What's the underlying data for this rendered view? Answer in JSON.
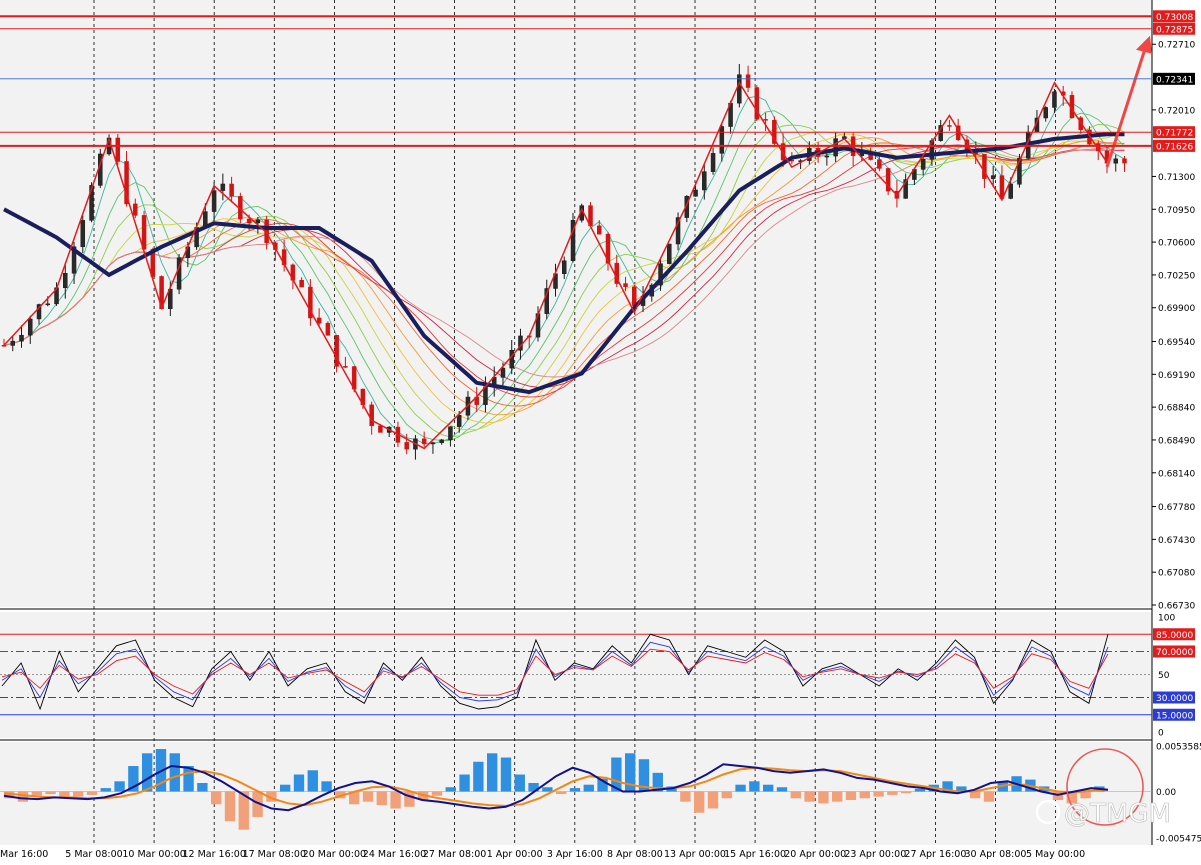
{
  "symbol_watermark": "@TMGM",
  "colors": {
    "background": "#f2f2f2",
    "grid": "#000000",
    "bull": "#1a1a1a",
    "bear": "#d11414",
    "zigzag": "#e31b1b",
    "trend": "#1a1f5c",
    "h_line": "#e31b1b",
    "current_line": "#3366cc",
    "rsi_fast": "#000000",
    "rsi_mid": "#2b3bd6",
    "rsi_slow": "#e31b1b",
    "hist_pos": "#2f8fe0",
    "hist_neg": "#f2a07a",
    "macd_line": "#12128a",
    "signal_line": "#f0881a",
    "circle": "#e85a5a"
  },
  "chart_data": [
    {
      "type": "candlestick",
      "panel": "price",
      "y_range": [
        0.6673,
        0.73075
      ],
      "y_ticks": [
        "0.72710",
        "0.72010",
        "0.71300",
        "0.70950",
        "0.70600",
        "0.70250",
        "0.69900",
        "0.69540",
        "0.69190",
        "0.68840",
        "0.68490",
        "0.68140",
        "0.67780",
        "0.67430",
        "0.67080",
        "0.66730"
      ],
      "x_labels": [
        "Mar 16:00",
        "5 Mar 08:00",
        "10 Mar 00:00",
        "12 Mar 16:00",
        "17 Mar 08:00",
        "20 Mar 00:00",
        "24 Mar 16:00",
        "27 Mar 08:00",
        "1 Apr 00:00",
        "3 Apr 16:00",
        "8 Apr 08:00",
        "13 Apr 00:00",
        "15 Apr 16:00",
        "20 Apr 00:00",
        "23 Apr 00:00",
        "27 Apr 16:00",
        "30 Apr 08:00",
        "5 May 00:00"
      ],
      "levels": [
        {
          "label": "0.73008",
          "value": 0.73008,
          "style": "thick"
        },
        {
          "label": "0.72875",
          "value": 0.72875,
          "style": "thin"
        },
        {
          "label": "0.71772",
          "value": 0.71772,
          "style": "thin"
        },
        {
          "label": "0.71626",
          "value": 0.71626,
          "style": "thick"
        }
      ],
      "current_price": {
        "label": "0.72341",
        "value": 0.72341
      },
      "zigzag": [
        [
          0,
          0.695
        ],
        [
          6,
          0.701
        ],
        [
          12,
          0.717
        ],
        [
          18,
          0.699
        ],
        [
          24,
          0.712
        ],
        [
          30,
          0.707
        ],
        [
          36,
          0.697
        ],
        [
          42,
          0.687
        ],
        [
          48,
          0.684
        ],
        [
          54,
          0.6895
        ],
        [
          60,
          0.696
        ],
        [
          66,
          0.7095
        ],
        [
          72,
          0.6985
        ],
        [
          78,
          0.71
        ],
        [
          84,
          0.723
        ],
        [
          90,
          0.714
        ],
        [
          96,
          0.717
        ],
        [
          102,
          0.711
        ],
        [
          108,
          0.7195
        ],
        [
          114,
          0.7105
        ],
        [
          120,
          0.723
        ],
        [
          126,
          0.7145
        ]
      ],
      "trend_ma": [
        [
          0,
          0.7095
        ],
        [
          6,
          0.7065
        ],
        [
          12,
          0.7025
        ],
        [
          18,
          0.7055
        ],
        [
          24,
          0.708
        ],
        [
          30,
          0.7075
        ],
        [
          36,
          0.7075
        ],
        [
          42,
          0.704
        ],
        [
          48,
          0.696
        ],
        [
          54,
          0.691
        ],
        [
          60,
          0.69
        ],
        [
          66,
          0.692
        ],
        [
          72,
          0.699
        ],
        [
          78,
          0.705
        ],
        [
          84,
          0.7115
        ],
        [
          90,
          0.715
        ],
        [
          96,
          0.716
        ],
        [
          102,
          0.715
        ],
        [
          108,
          0.7155
        ],
        [
          114,
          0.716
        ],
        [
          120,
          0.717
        ],
        [
          126,
          0.7175
        ]
      ],
      "forecast_arrow": {
        "from": [
          126,
          0.714
        ],
        "to": [
          130,
          0.728
        ]
      }
    },
    {
      "type": "line",
      "panel": "rsi",
      "y_range": [
        0,
        100
      ],
      "y_ticks": [
        "100",
        "50",
        "0"
      ],
      "levels": [
        {
          "label": "85.0000",
          "value": 85,
          "color": "#e31b1b",
          "style": "solid"
        },
        {
          "label": "70.0000",
          "value": 70,
          "color": "#e31b1b",
          "style": "dashdot"
        },
        {
          "label": "30.0000",
          "value": 30,
          "color": "#2b3bd6",
          "style": "dashdot"
        },
        {
          "label": "15.0000",
          "value": 15,
          "color": "#2b3bd6",
          "style": "solid"
        }
      ],
      "series": [
        {
          "color": "#000000",
          "values": [
            40,
            60,
            20,
            70,
            35,
            55,
            75,
            80,
            45,
            30,
            22,
            55,
            70,
            45,
            70,
            40,
            55,
            60,
            35,
            25,
            60,
            45,
            65,
            40,
            25,
            20,
            22,
            30,
            80,
            45,
            60,
            55,
            75,
            60,
            85,
            80,
            50,
            75,
            70,
            65,
            80,
            70,
            40,
            55,
            60,
            50,
            40,
            55,
            45,
            60,
            80,
            65,
            25,
            45,
            80,
            70,
            35,
            25,
            85
          ]
        },
        {
          "color": "#2b3bd6",
          "values": [
            45,
            55,
            30,
            62,
            42,
            52,
            68,
            72,
            48,
            35,
            28,
            52,
            64,
            48,
            64,
            44,
            52,
            56,
            40,
            30,
            56,
            47,
            60,
            43,
            30,
            27,
            28,
            34,
            72,
            48,
            58,
            54,
            70,
            58,
            78,
            74,
            52,
            70,
            66,
            62,
            74,
            66,
            45,
            53,
            57,
            50,
            44,
            53,
            48,
            57,
            74,
            62,
            32,
            46,
            74,
            66,
            40,
            32,
            74
          ]
        },
        {
          "color": "#e31b1b",
          "values": [
            48,
            52,
            38,
            58,
            46,
            50,
            62,
            66,
            50,
            40,
            33,
            50,
            60,
            50,
            60,
            47,
            51,
            54,
            44,
            35,
            53,
            48,
            57,
            46,
            35,
            32,
            32,
            37,
            66,
            50,
            56,
            54,
            66,
            57,
            72,
            70,
            54,
            66,
            63,
            60,
            69,
            63,
            48,
            52,
            55,
            50,
            47,
            52,
            50,
            55,
            68,
            60,
            38,
            48,
            68,
            63,
            44,
            38,
            68
          ]
        }
      ]
    },
    {
      "type": "bar",
      "panel": "macd",
      "y_range": [
        -0.005475,
        0.005358
      ],
      "y_ticks": [
        "0.0053585",
        "0.00",
        "-0.005475"
      ],
      "histogram": [
        -0.0008,
        -0.0012,
        -0.0005,
        -0.0003,
        -0.0008,
        -0.0006,
        -0.0004,
        0.0004,
        0.0012,
        0.003,
        0.0045,
        0.005,
        0.0045,
        0.003,
        0.001,
        -0.0015,
        -0.0035,
        -0.0045,
        -0.003,
        -0.0012,
        0.0008,
        0.002,
        0.0025,
        0.0012,
        -0.0008,
        -0.0015,
        -0.0012,
        -0.0016,
        -0.002,
        -0.0018,
        -0.001,
        -0.0005,
        0.0005,
        0.002,
        0.0035,
        0.0045,
        0.004,
        0.002,
        0.001,
        0.0005,
        -0.0003,
        0.0004,
        0.0008,
        0.0015,
        0.004,
        0.0045,
        0.0038,
        0.0022,
        0.0006,
        -0.0012,
        -0.0025,
        -0.002,
        -0.0008,
        0.0008,
        0.0012,
        0.0008,
        0.0005,
        -0.0008,
        -0.0012,
        -0.0014,
        -0.0012,
        -0.001,
        -0.0008,
        -0.0006,
        -0.0004,
        -0.0002,
        0.0003,
        0.0008,
        0.0012,
        0.0006,
        -0.0008,
        -0.0012,
        0.0012,
        0.0018,
        0.0014,
        0.0006,
        -0.001,
        -0.0014,
        -0.0008,
        0.0006
      ],
      "macd_line": [
        -0.0005,
        -0.0008,
        -0.0009,
        -0.0007,
        -0.0008,
        -0.0009,
        -0.0007,
        -0.0002,
        0.0008,
        0.002,
        0.003,
        0.0028,
        0.0022,
        0.0012,
        0.0,
        -0.0012,
        -0.002,
        -0.0022,
        -0.0015,
        -0.0005,
        0.0004,
        0.001,
        0.0012,
        0.0006,
        -0.0004,
        -0.001,
        -0.0012,
        -0.0015,
        -0.0018,
        -0.002,
        -0.0018,
        -0.001,
        0.0004,
        0.0018,
        0.0028,
        0.0022,
        0.001,
        0.0,
        0.0,
        0.0002,
        0.0004,
        0.001,
        0.002,
        0.0032,
        0.003,
        0.0028,
        0.0024,
        0.0022,
        0.0024,
        0.0026,
        0.0022,
        0.0016,
        0.0014,
        0.001,
        0.0006,
        0.0004,
        0.0,
        -0.0002,
        0.0002,
        0.001,
        0.0012,
        0.0006,
        0.0,
        -0.0004,
        0.0,
        0.0004,
        0.0002
      ],
      "signal_line": [
        -0.0002,
        -0.0004,
        -0.0006,
        -0.0007,
        -0.0007,
        -0.0008,
        -0.0008,
        -0.0006,
        -0.0002,
        0.0006,
        0.0016,
        0.0022,
        0.0024,
        0.002,
        0.0012,
        0.0002,
        -0.0008,
        -0.0014,
        -0.0016,
        -0.0012,
        -0.0006,
        0.0,
        0.0005,
        0.0006,
        0.0002,
        -0.0004,
        -0.0008,
        -0.0011,
        -0.0014,
        -0.0016,
        -0.0017,
        -0.0015,
        -0.0008,
        0.0002,
        0.0012,
        0.0018,
        0.0016,
        0.001,
        0.0006,
        0.0004,
        0.0004,
        0.0006,
        0.0012,
        0.002,
        0.0026,
        0.0028,
        0.0027,
        0.0025,
        0.0024,
        0.0025,
        0.0024,
        0.002,
        0.0016,
        0.0012,
        0.0009,
        0.0006,
        0.0003,
        0.0,
        0.0,
        0.0004,
        0.0008,
        0.0008,
        0.0004,
        0.0,
        -0.0001,
        0.0001,
        0.0002
      ]
    }
  ]
}
